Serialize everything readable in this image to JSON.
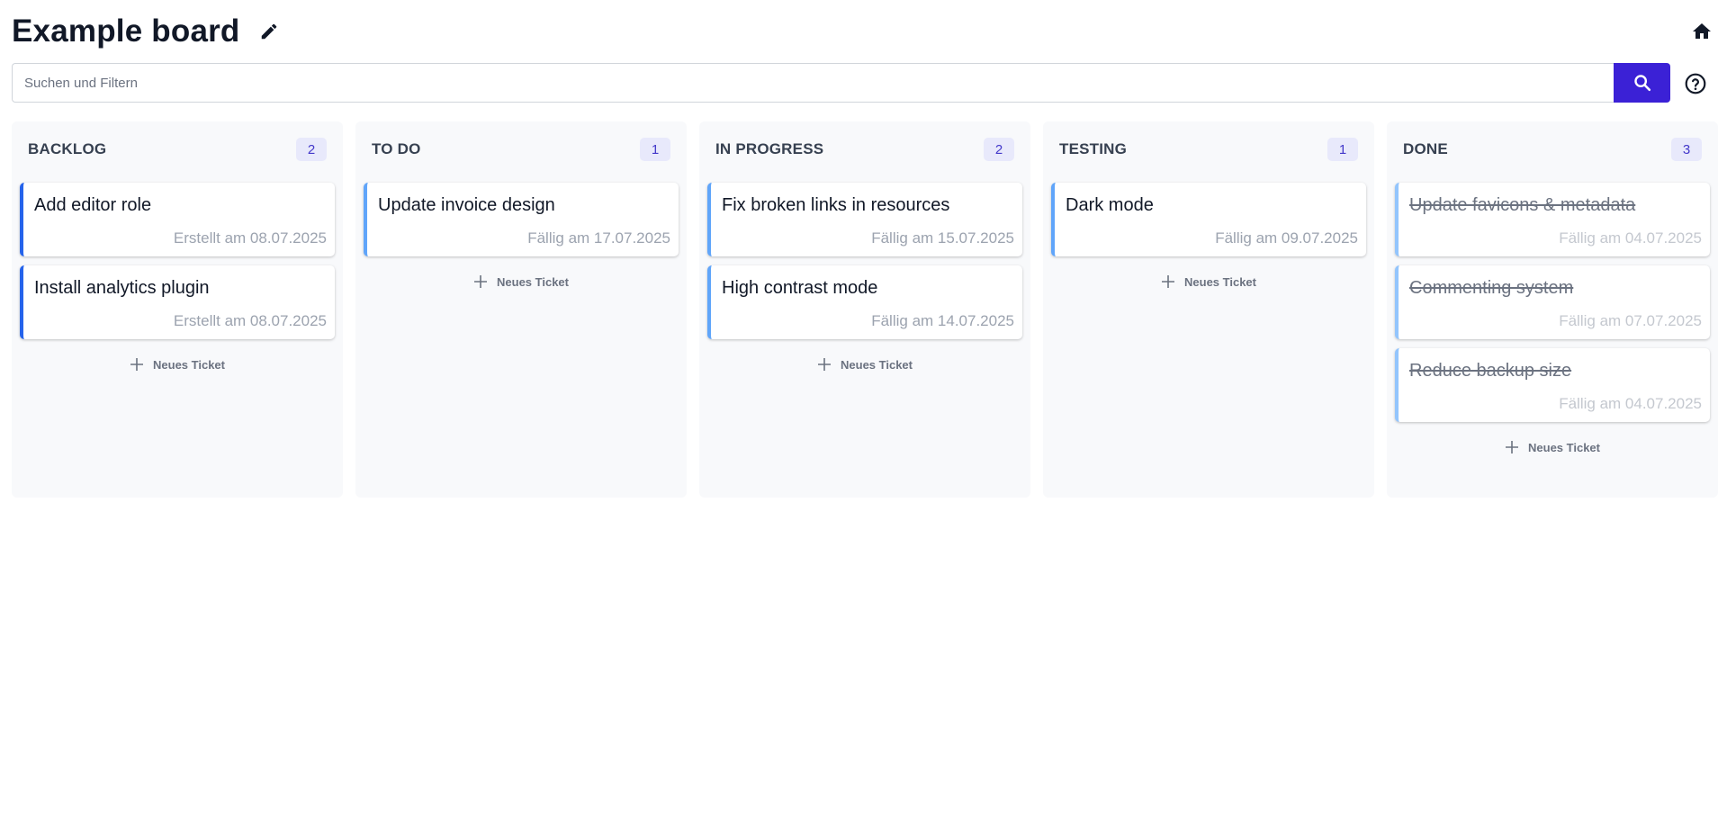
{
  "header": {
    "title": "Example board",
    "edit_icon": "pencil-icon",
    "home_icon": "home-icon"
  },
  "search": {
    "placeholder": "Suchen und Filtern",
    "value": "",
    "button_icon": "search-icon",
    "help_icon": "help-circle-icon"
  },
  "colors": {
    "accent": "#3b21d6",
    "card_border_dark": "#2563eb",
    "card_border": "#60a5fa",
    "card_border_light": "#93c5fd",
    "count_badge_bg": "#e8e9fb"
  },
  "columns": [
    {
      "title": "BACKLOG",
      "count": "2",
      "new_ticket_label": "Neues Ticket",
      "cards": [
        {
          "title": "Add editor role",
          "date": "Erstellt am 08.07.2025"
        },
        {
          "title": "Install analytics plugin",
          "date": "Erstellt am 08.07.2025"
        }
      ]
    },
    {
      "title": "TO DO",
      "count": "1",
      "new_ticket_label": "Neues Ticket",
      "cards": [
        {
          "title": "Update invoice design",
          "date": "Fällig am 17.07.2025"
        }
      ]
    },
    {
      "title": "IN PROGRESS",
      "count": "2",
      "new_ticket_label": "Neues Ticket",
      "cards": [
        {
          "title": "Fix broken links in resources",
          "date": "Fällig am 15.07.2025"
        },
        {
          "title": "High contrast mode",
          "date": "Fällig am 14.07.2025"
        }
      ]
    },
    {
      "title": "TESTING",
      "count": "1",
      "new_ticket_label": "Neues Ticket",
      "cards": [
        {
          "title": "Dark mode",
          "date": "Fällig am 09.07.2025"
        }
      ]
    },
    {
      "title": "DONE",
      "count": "3",
      "new_ticket_label": "Neues Ticket",
      "cards": [
        {
          "title": "Update favicons & metadata",
          "date": "Fällig am 04.07.2025"
        },
        {
          "title": "Commenting system",
          "date": "Fällig am 07.07.2025"
        },
        {
          "title": "Reduce backup size",
          "date": "Fällig am 04.07.2025"
        }
      ]
    }
  ]
}
